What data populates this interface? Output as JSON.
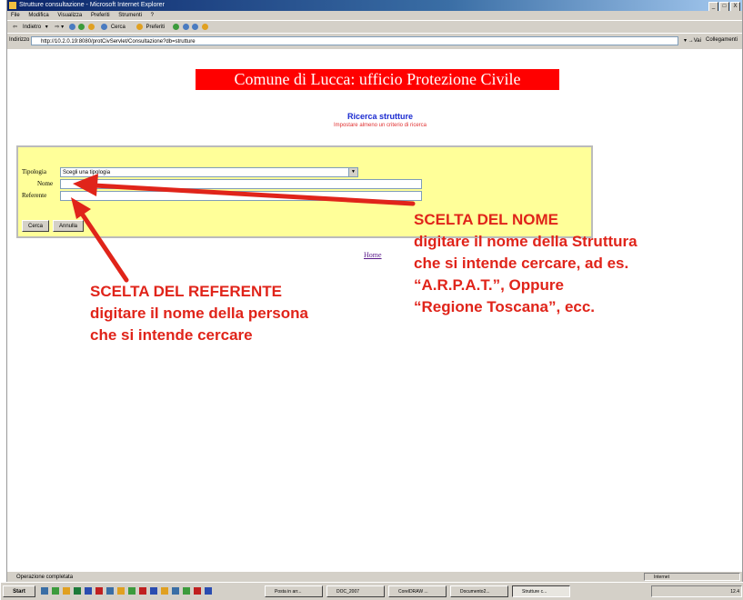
{
  "window": {
    "title": "Strutture consultazione - Microsoft Internet Explorer",
    "controls": [
      "_",
      "□",
      "X"
    ]
  },
  "menu": [
    "File",
    "Modifica",
    "Visualizza",
    "Preferiti",
    "Strumenti",
    "?"
  ],
  "toolbar": {
    "back": "Indietro",
    "search": "Cerca",
    "favorites": "Preferiti"
  },
  "address": {
    "label": "Indirizzo",
    "url": "http://10.2.0.19:8080/protCivServlet/Consultazione?db=strutture",
    "go": "Vai",
    "links": "Collegamenti"
  },
  "page": {
    "banner": "Comune di Lucca: ufficio Protezione Civile",
    "search_title": "Ricerca strutture",
    "search_subtitle": "Impostare almeno un criterio di ricerca",
    "form": {
      "tipologia_label": "Tipologia",
      "tipologia_value": "Scegli una tipologia",
      "nome_label": "Nome",
      "nome_value": "",
      "referente_label": "Referente",
      "referente_value": "",
      "search_button": "Cerca",
      "cancel_button": "Annulla"
    },
    "home_link": "Home"
  },
  "annotations": {
    "nome": {
      "title": "SCELTA DEL NOME",
      "lines": [
        "digitare il nome della Struttura",
        "che si intende cercare, ad es.",
        "“A.R.P.A.T.”, Oppure",
        "“Regione Toscana”, ecc."
      ]
    },
    "referente": {
      "title": "SCELTA DEL REFERENTE",
      "lines": [
        "digitare il nome della persona",
        "che si intende cercare"
      ]
    },
    "arrow_color": "#e0241a"
  },
  "status": {
    "text": "Operazione completata",
    "zone": "Internet"
  },
  "taskbar": {
    "start": "Start",
    "buttons": [
      "Posta in arr...",
      "DOC_2007",
      "CorelDRAW ...",
      "Documento2...",
      "Strutture c..."
    ],
    "clock": "12.4"
  }
}
